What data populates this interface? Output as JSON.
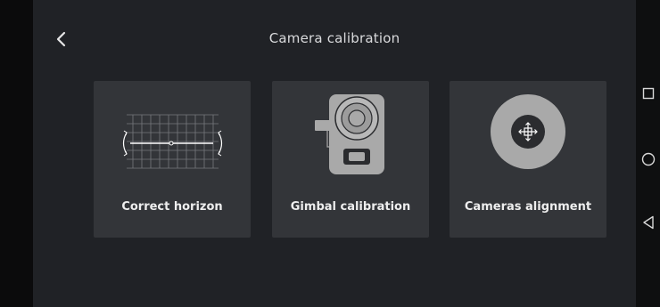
{
  "header": {
    "title": "Camera calibration",
    "back_icon": "chevron-left-icon"
  },
  "cards": [
    {
      "label": "Correct horizon",
      "icon": "horizon-grid-icon"
    },
    {
      "label": "Gimbal calibration",
      "icon": "gimbal-camera-icon"
    },
    {
      "label": "Cameras alignment",
      "icon": "alignment-move-icon"
    }
  ],
  "system_nav": {
    "buttons": [
      "recent-apps-icon",
      "home-icon",
      "back-triangle-icon"
    ]
  },
  "colors": {
    "background": "#202226",
    "card": "#333539",
    "text": "#eeeeee",
    "icon_light": "#a9a9a9",
    "icon_dark": "#2b2c2f"
  }
}
